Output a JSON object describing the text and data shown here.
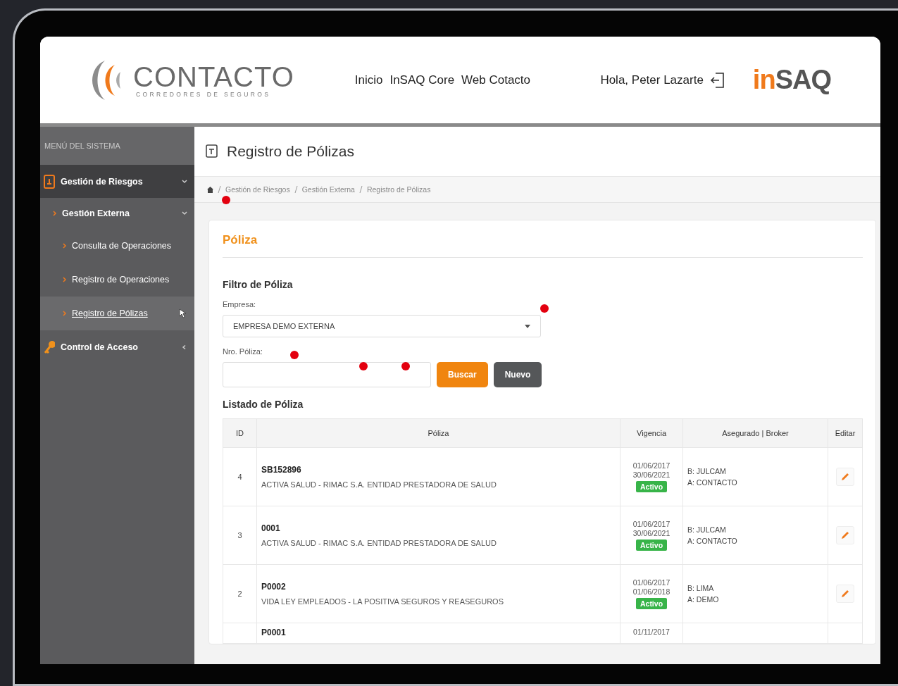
{
  "header": {
    "logo": {
      "name": "CONTACTO",
      "tagline": "CORREDORES DE SEGUROS"
    },
    "nav": [
      {
        "label": "Inicio"
      },
      {
        "label": "InSAQ Core"
      },
      {
        "label": "Web Cotacto"
      }
    ],
    "greeting": "Hola, Peter Lazarte",
    "brand": {
      "prefix": "in",
      "name": "SAQ"
    }
  },
  "sidebar": {
    "title": "MENÚ DEL SISTEMA",
    "items": [
      {
        "label": "Gestión de Riesgos",
        "selected": false,
        "expanded": true,
        "children": [
          {
            "label": "Gestión Externa",
            "selected": false,
            "expanded": true,
            "children": [
              {
                "label": "Consulta de Operaciones",
                "selected": false
              },
              {
                "label": "Registro de Operaciones",
                "selected": false
              },
              {
                "label": "Registro de Pólizas",
                "selected": true
              }
            ]
          }
        ]
      },
      {
        "label": "Control de Acceso",
        "selected": false,
        "expanded": false
      }
    ]
  },
  "page": {
    "title": "Registro de Pólizas",
    "breadcrumb": [
      "Gestión de Riesgos",
      "Gestión Externa",
      "Registro de Pólizas"
    ],
    "card": {
      "title": "Póliza",
      "filter_title": "Filtro de Póliza",
      "fields": [
        {
          "kind": "select",
          "label": "Empresa:",
          "value": "EMPRESA DEMO EXTERNA"
        },
        {
          "kind": "text",
          "label": "Nro. Póliza:"
        }
      ],
      "buttons": [
        {
          "label": "Buscar",
          "kind": "primary"
        },
        {
          "label": "Nuevo",
          "kind": "secondary"
        }
      ],
      "list_title": "Listado de Póliza",
      "table": {
        "columns": [
          "ID",
          "Póliza",
          "Vigencia",
          "Asegurado | Broker",
          "Editar"
        ],
        "rows": [
          {
            "id": "4",
            "code": "SB152896",
            "description": "ACTIVA SALUD - RIMAC S.A. ENTIDAD PRESTADORA DE SALUD",
            "start": "01/06/2017",
            "end": "30/06/2021",
            "status": "Activo",
            "insured": "B: JULCAM",
            "broker": "A: CONTACTO"
          },
          {
            "id": "3",
            "code": "0001",
            "description": "ACTIVA SALUD - RIMAC S.A. ENTIDAD PRESTADORA DE SALUD",
            "start": "01/06/2017",
            "end": "30/06/2021",
            "status": "Activo",
            "insured": "B: JULCAM",
            "broker": "A: CONTACTO"
          },
          {
            "id": "2",
            "code": "P0002",
            "description": "VIDA LEY EMPLEADOS - LA POSITIVA SEGUROS Y REASEGUROS",
            "start": "01/06/2017",
            "end": "01/06/2018",
            "status": "Activo",
            "insured": "B: LIMA",
            "broker": "A: DEMO"
          },
          {
            "code": "P0001",
            "start": "01/11/2017"
          }
        ]
      }
    }
  }
}
